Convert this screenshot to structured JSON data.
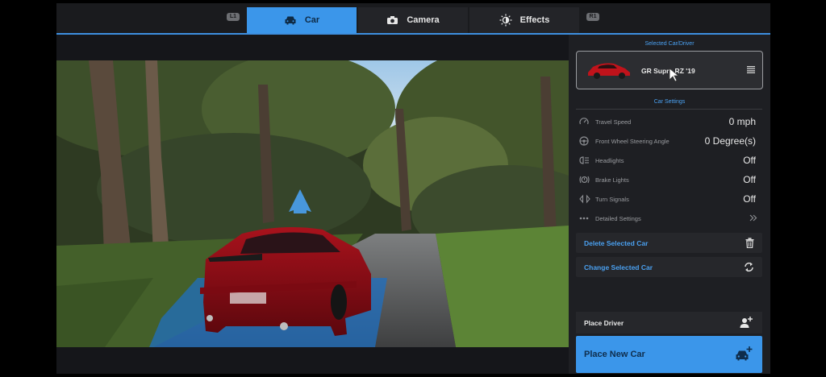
{
  "tabs": {
    "left_bumper": "L1",
    "right_bumper": "R1",
    "items": [
      {
        "label": "Car",
        "icon": "car-icon",
        "active": true
      },
      {
        "label": "Camera",
        "icon": "camera-icon",
        "active": false
      },
      {
        "label": "Effects",
        "icon": "effects-icon",
        "active": false
      }
    ]
  },
  "panel": {
    "selected_title": "Selected Car/Driver",
    "selected_car": {
      "name": "GR Supra RZ '19",
      "color": "#c0131b"
    },
    "settings_title": "Car Settings",
    "settings": [
      {
        "label": "Travel Speed",
        "value": "0 mph",
        "icon": "speedometer-icon"
      },
      {
        "label": "Front Wheel Steering Angle",
        "value": "0 Degree(s)",
        "icon": "steering-wheel-icon"
      },
      {
        "label": "Headlights",
        "value": "Off",
        "icon": "headlight-icon"
      },
      {
        "label": "Brake Lights",
        "value": "Off",
        "icon": "brake-light-icon"
      },
      {
        "label": "Turn Signals",
        "value": "Off",
        "icon": "turn-signal-icon"
      },
      {
        "label": "Detailed Settings",
        "value": "",
        "icon": "more-dots-icon"
      }
    ],
    "delete_label": "Delete Selected Car",
    "change_label": "Change Selected Car",
    "place_driver_label": "Place Driver",
    "place_car_label": "Place New Car"
  },
  "colors": {
    "accent": "#3b96ea",
    "panel_bg": "#1e1f23"
  }
}
